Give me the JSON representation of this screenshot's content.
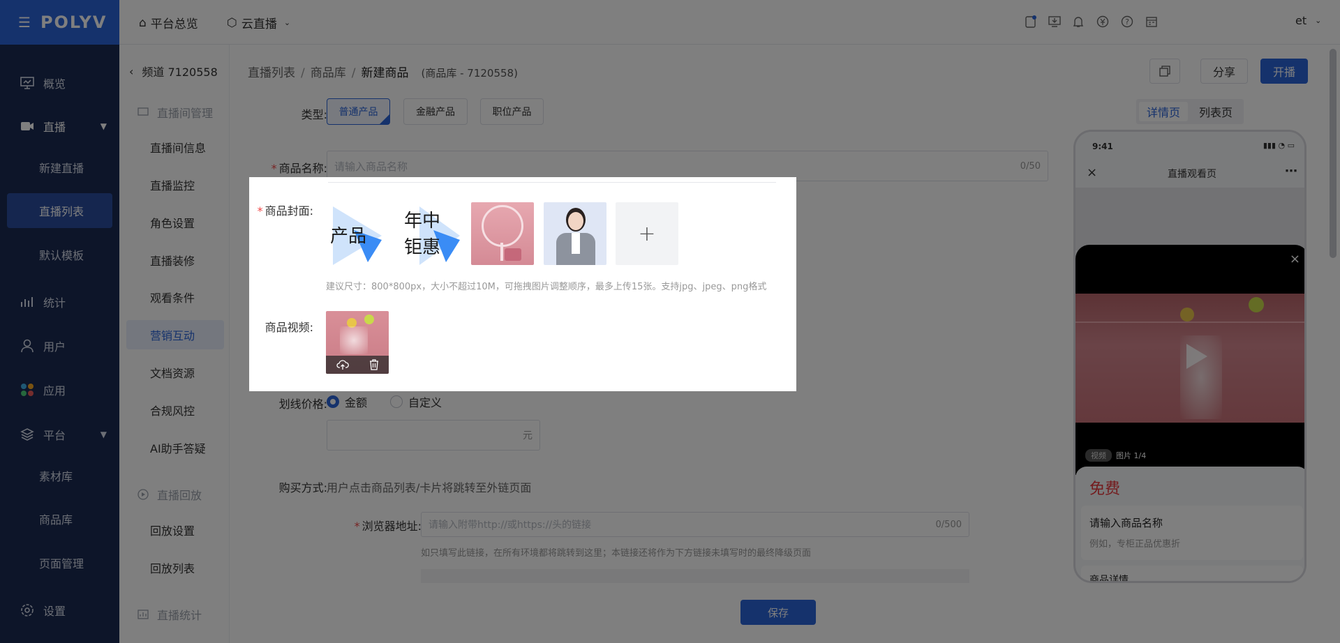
{
  "nav": {
    "brand": "POLYV",
    "items": [
      {
        "label": "概览",
        "icon": "monitor-icon"
      },
      {
        "label": "直播",
        "icon": "video-camera-icon"
      },
      {
        "label": "统计",
        "icon": "bar-chart-icon"
      },
      {
        "label": "用户",
        "icon": "user-icon"
      },
      {
        "label": "应用",
        "icon": "apps-icon"
      },
      {
        "label": "平台",
        "icon": "layers-icon"
      },
      {
        "label": "设置",
        "icon": "gear-icon"
      }
    ],
    "live_sub": [
      "新建直播",
      "直播列表",
      "默认模板"
    ],
    "platform_sub": [
      "素材库",
      "商品库",
      "页面管理"
    ]
  },
  "topbar": {
    "overview": "平台总览",
    "product": "云直播",
    "user": "et"
  },
  "side2": {
    "back": "频道 7120558",
    "group1": "直播间管理",
    "group1_items": [
      "直播间信息",
      "直播监控",
      "角色设置",
      "直播装修",
      "观看条件",
      "营销互动",
      "文档资源",
      "合规风控",
      "AI助手答疑"
    ],
    "group2": "直播回放",
    "group2_items": [
      "回放设置",
      "回放列表"
    ],
    "group3": "直播统计"
  },
  "breadcrumb": {
    "b1": "直播列表",
    "sep": "/",
    "b2": "商品库",
    "b3": "新建商品",
    "sub": "(商品库 - 7120558)"
  },
  "header_actions": {
    "share": "分享",
    "start": "开播"
  },
  "form": {
    "type_label": "类型:",
    "types": [
      "普通产品",
      "金融产品",
      "职位产品"
    ],
    "name_label": "商品名称:",
    "name_placeholder": "请输入商品名称",
    "name_count": "0/50",
    "cover_label": "商品封面:",
    "cover_thumbs": [
      {
        "text": "产品"
      },
      {
        "text1": "年中",
        "text2": "钜惠"
      }
    ],
    "cover_hint": "建议尺寸：800*800px，大小不超过10M，可拖拽图片调整顺序，最多上传15张。支持jpg、jpeg、png格式",
    "video_label": "商品视频:",
    "strike_label": "划线价格:",
    "strike_opt1": "金额",
    "strike_opt2": "自定义",
    "yuan": "元",
    "buy_label": "购买方式:",
    "buy_desc": "用户点击商品列表/卡片将跳转至外链页面",
    "url_label": "浏览器地址:",
    "url_placeholder": "请输入附带http://或https://头的链接",
    "url_count": "0/500",
    "url_hint": "如只填写此链接，在所有环境都将跳转到这里；本链接还将作为下方链接未填写时的最终降级页面",
    "save": "保存"
  },
  "preview": {
    "tab_detail": "详情页",
    "tab_list": "列表页",
    "time": "9:41",
    "title": "直播观看页",
    "video_tag": "视频",
    "pic_count": "图片 1/4",
    "price": "免费",
    "name": "请输入商品名称",
    "desc": "例如，专柜正品优惠折",
    "detail": "商品详情"
  }
}
